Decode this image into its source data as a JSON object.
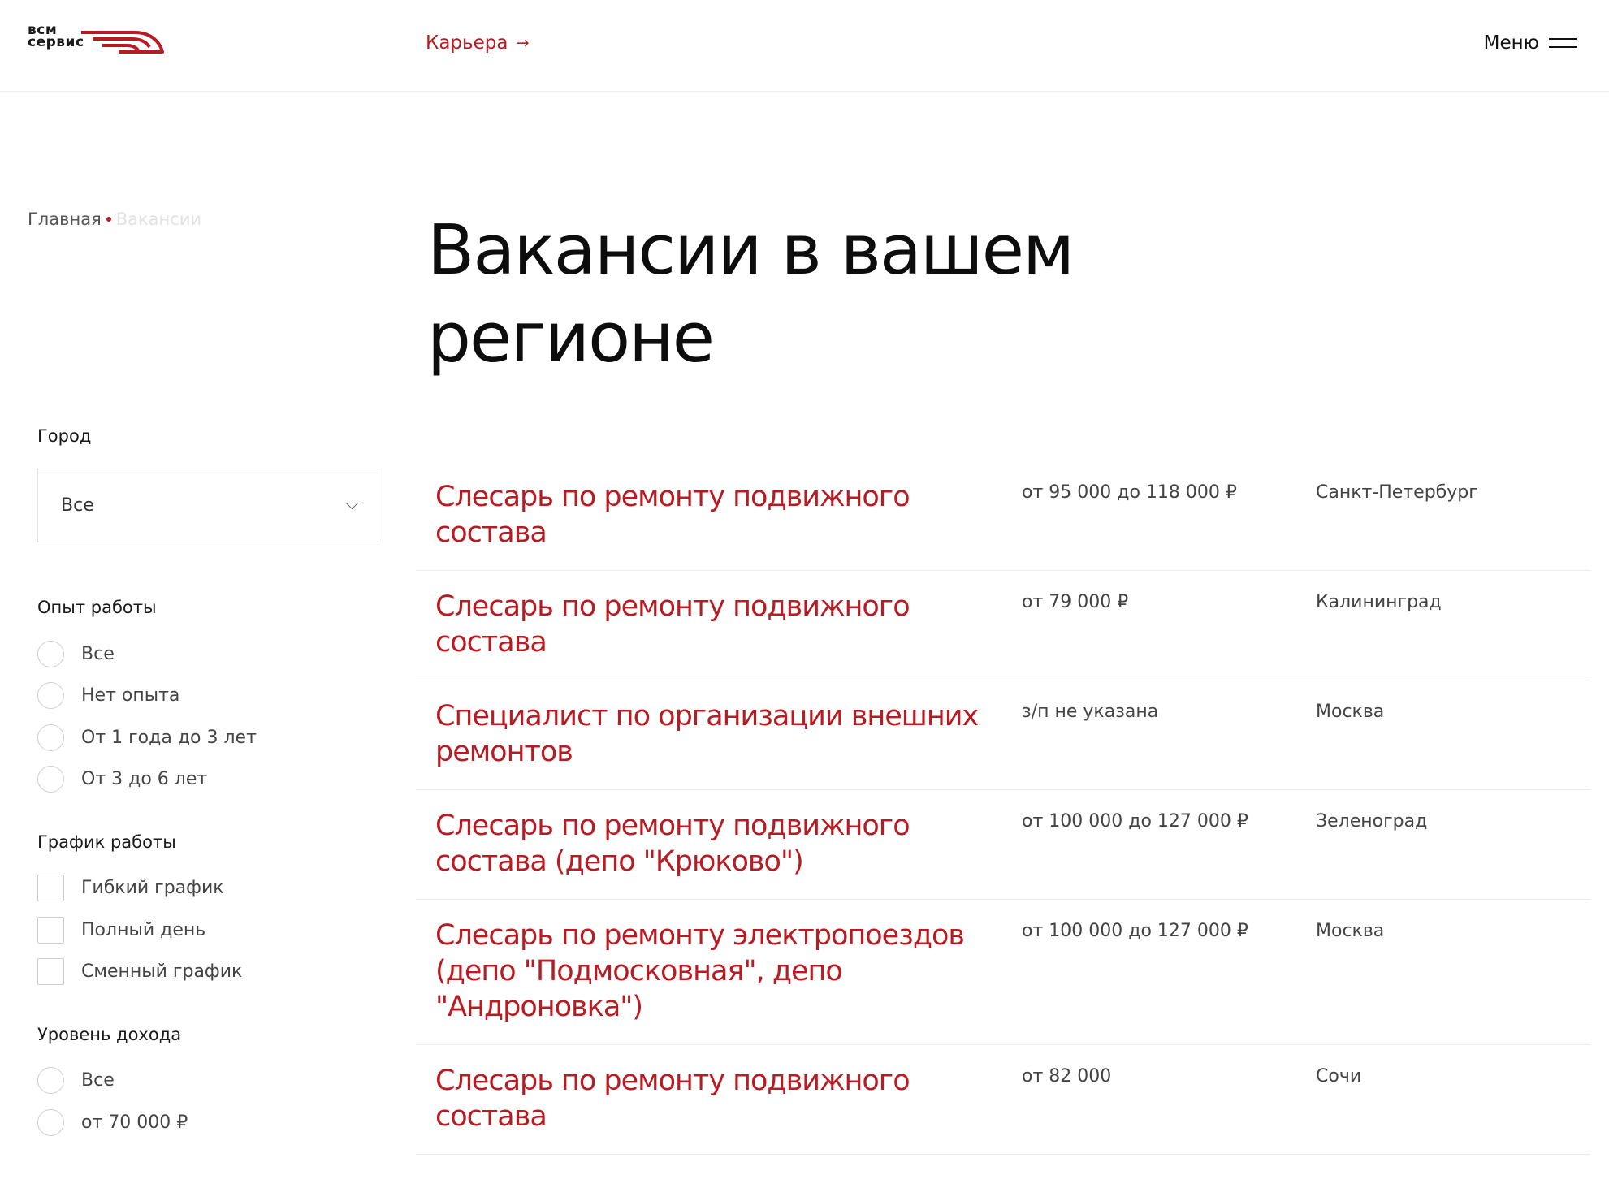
{
  "header": {
    "logo": {
      "line1": "всм",
      "line2": "сервис"
    },
    "career_label": "Карьера",
    "career_arrow": "→",
    "menu_label": "Меню"
  },
  "breadcrumb": {
    "home": "Главная",
    "current": "Вакансии"
  },
  "page_title": "Вакансии в вашем регионе",
  "filters": {
    "city": {
      "title": "Город",
      "selected": "Все"
    },
    "experience": {
      "title": "Опыт работы",
      "options": [
        "Все",
        "Нет опыта",
        "От 1 года до 3 лет",
        "От 3 до 6 лет"
      ]
    },
    "schedule": {
      "title": "График работы",
      "options": [
        "Гибкий график",
        "Полный день",
        "Сменный график"
      ]
    },
    "income": {
      "title": "Уровень дохода",
      "options": [
        "Все",
        "от 70 000 ₽"
      ]
    }
  },
  "vacancies": [
    {
      "title": "Слесарь по ремонту подвижного состава",
      "salary": "от 95 000 до 118 000 ₽",
      "city": "Санкт-Петербург"
    },
    {
      "title": "Слесарь по ремонту подвижного состава",
      "salary": "от 79 000 ₽",
      "city": "Калининград"
    },
    {
      "title": "Специалист по организации внешних ремонтов",
      "salary": "з/п не указана",
      "city": "Москва"
    },
    {
      "title": "Слесарь по ремонту подвижного состава (депо \"Крюково\")",
      "salary": "от 100 000 до 127 000 ₽",
      "city": "Зеленоград"
    },
    {
      "title": "Слесарь по ремонту электропоездов (депо \"Подмосковная\", депо \"Андроновка\")",
      "salary": "от 100 000 до 127 000 ₽",
      "city": "Москва"
    },
    {
      "title": "Слесарь по ремонту подвижного состава",
      "salary": "от 82 000",
      "city": "Сочи"
    }
  ],
  "colors": {
    "accent": "#b81c22",
    "text": "#1a1a1a",
    "muted": "#444444",
    "divider": "#ececec"
  }
}
